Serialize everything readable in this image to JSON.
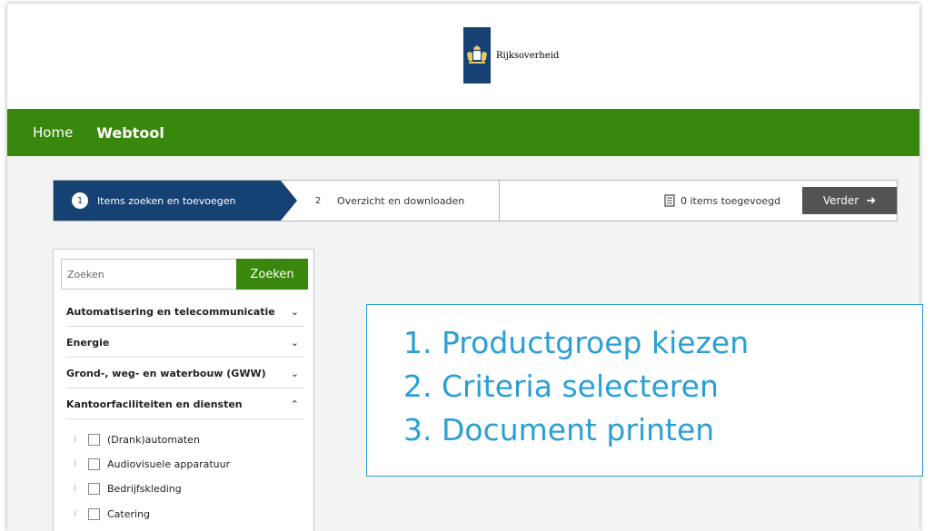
{
  "header": {
    "logo_text": "Rijksoverheid",
    "logo_icon": "coat-of-arms"
  },
  "nav": {
    "home": "Home",
    "webtool": "Webtool"
  },
  "steps": {
    "step1": {
      "num": "1",
      "label": "Items zoeken en toevoegen"
    },
    "step2": {
      "num": "2",
      "label": "Overzicht en downloaden"
    },
    "counter": "0 items toegevoegd",
    "counter_icon": "document-icon",
    "next_button": "Verder",
    "next_icon": "arrow-right"
  },
  "sidebar": {
    "search": {
      "placeholder": "Zoeken",
      "button": "Zoeken"
    },
    "categories": [
      {
        "label": "Automatisering en telecommunicatie",
        "chevron": "⌄"
      },
      {
        "label": "Energie",
        "chevron": "⌄"
      },
      {
        "label": "Grond-, weg- en waterbouw (GWW)",
        "chevron": "⌄"
      },
      {
        "label": "Kantoorfaciliteiten en diensten",
        "chevron": "⌃"
      }
    ],
    "subitems": [
      {
        "label": "(Drank)automaten",
        "info": "i"
      },
      {
        "label": "Audiovisuele apparatuur",
        "info": "i"
      },
      {
        "label": "Bedrijfskleding",
        "info": "i"
      },
      {
        "label": "Catering",
        "info": "i"
      }
    ]
  },
  "callout": {
    "items": [
      "1.  Productgroep kiezen",
      "2.  Criteria selecteren",
      "3.  Document printen"
    ]
  },
  "colors": {
    "green": "#39870c",
    "navy": "#154273",
    "callout_blue": "#2a9fd6",
    "button_grey": "#535353"
  }
}
